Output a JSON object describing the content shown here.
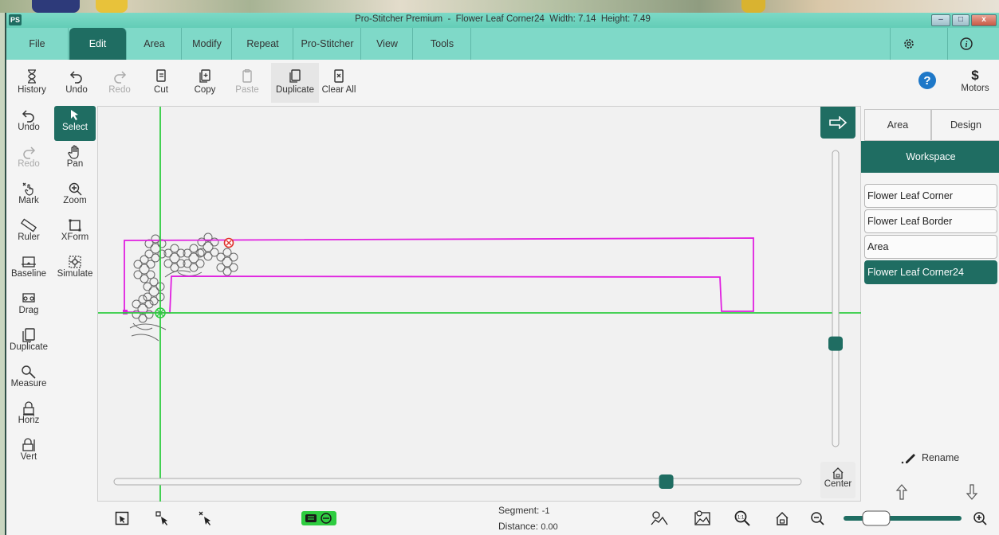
{
  "window": {
    "badge": "PS",
    "title": "Pro-Stitcher Premium  -  Flower Leaf Corner24  Width: 7.14  Height: 7.49",
    "controls": {
      "minimize": "‒",
      "maximize": "□",
      "close": "x"
    }
  },
  "menu": {
    "tabs": [
      {
        "label": "File"
      },
      {
        "label": "Edit",
        "active": true
      },
      {
        "label": "Area"
      },
      {
        "label": "Modify"
      },
      {
        "label": "Repeat"
      },
      {
        "label": "Pro-Stitcher"
      },
      {
        "label": "View"
      },
      {
        "label": "Tools"
      }
    ]
  },
  "toolbar": {
    "history": "History",
    "undo": "Undo",
    "redo": "Redo",
    "cut": "Cut",
    "copy": "Copy",
    "paste": "Paste",
    "duplicate": "Duplicate",
    "clear_all": "Clear All",
    "motors": "Motors",
    "motors_glyph": "$"
  },
  "left_tools": {
    "undo": "Undo",
    "select": "Select",
    "redo": "Redo",
    "pan": "Pan",
    "mark": "Mark",
    "zoom": "Zoom",
    "ruler": "Ruler",
    "xform": "XForm",
    "baseline": "Baseline",
    "simulate": "Simulate",
    "drag": "Drag",
    "duplicate": "Duplicate",
    "measure": "Measure",
    "horiz": "Horiz",
    "vert": "Vert"
  },
  "canvas": {
    "center_label": "Center",
    "vertical_slider_value": 0.66,
    "horizontal_slider_value": 0.81
  },
  "right_panel": {
    "tabs": {
      "area": "Area",
      "design": "Design"
    },
    "workspace": "Workspace",
    "layers": [
      {
        "name": "Flower Leaf Corner",
        "selected": false
      },
      {
        "name": "Flower Leaf Border",
        "selected": false
      },
      {
        "name": "Area",
        "selected": false
      },
      {
        "name": "Flower Leaf Corner24",
        "selected": true
      }
    ],
    "rename": "Rename"
  },
  "status": {
    "segment_label": "Segment:",
    "segment_value": "-1",
    "distance_label": "Distance:",
    "distance_value": "0.00"
  },
  "colors": {
    "accent": "#1f6d62",
    "menu_bg": "#7fd9c8",
    "guide_green": "#2ecc40",
    "design_outline": "#e020e0"
  }
}
